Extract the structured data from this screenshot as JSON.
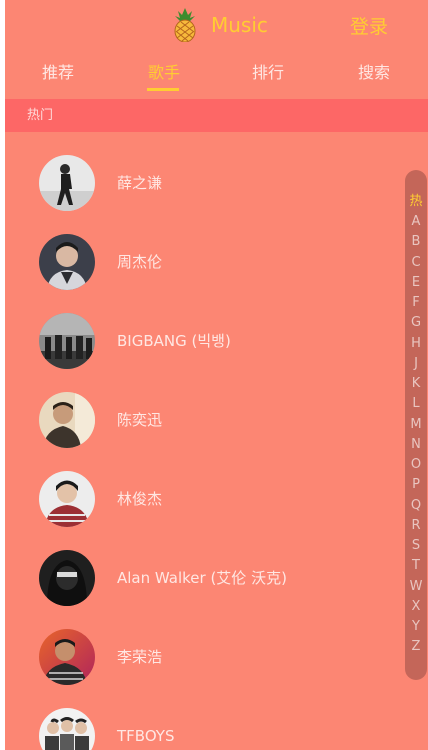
{
  "header": {
    "title": "Music",
    "login_label": "登录",
    "logo_icon": "pineapple-icon"
  },
  "tabs": [
    {
      "label": "推荐",
      "active": false
    },
    {
      "label": "歌手",
      "active": true
    },
    {
      "label": "排行",
      "active": false
    },
    {
      "label": "搜索",
      "active": false
    }
  ],
  "section": {
    "title": "热门"
  },
  "singers": [
    {
      "name": "薛之谦"
    },
    {
      "name": "周杰伦"
    },
    {
      "name": "BIGBANG (빅뱅)"
    },
    {
      "name": "陈奕迅"
    },
    {
      "name": "林俊杰"
    },
    {
      "name": "Alan Walker (艾伦 沃克)"
    },
    {
      "name": "李荣浩"
    },
    {
      "name": "TFBOYS"
    }
  ],
  "shortcut": {
    "active": "热",
    "items": [
      "热",
      "A",
      "B",
      "C",
      "E",
      "F",
      "G",
      "H",
      "J",
      "K",
      "L",
      "M",
      "N",
      "O",
      "P",
      "Q",
      "R",
      "S",
      "T",
      "W",
      "X",
      "Y",
      "Z"
    ]
  },
  "colors": {
    "background": "#fc8673",
    "accent": "#ffcd32",
    "section_bar": "#fd6766"
  }
}
